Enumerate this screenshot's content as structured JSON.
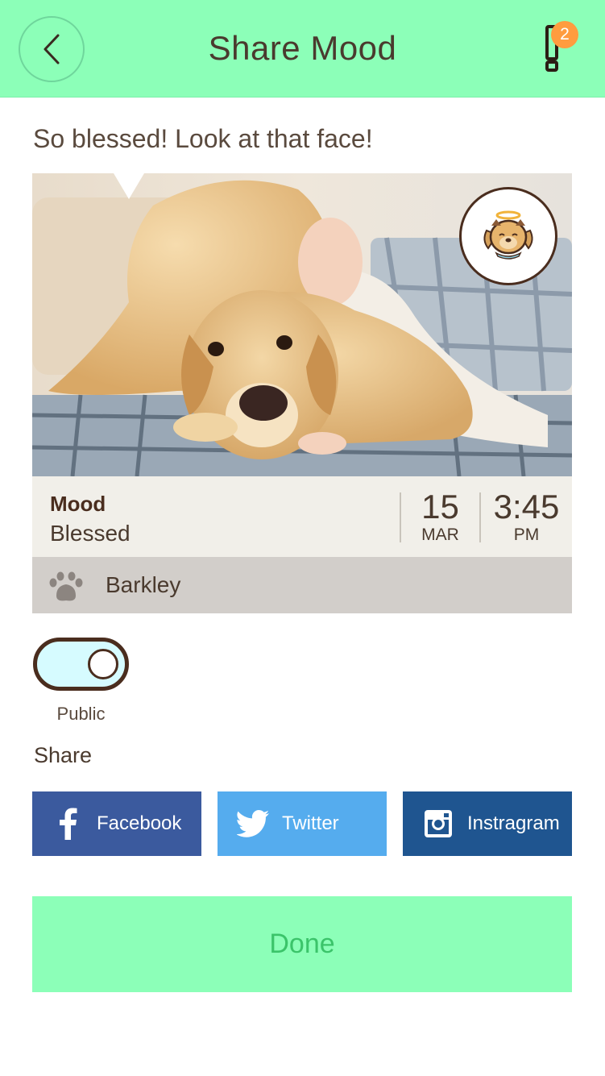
{
  "header": {
    "title": "Share Mood",
    "notification_count": "2"
  },
  "post": {
    "caption": "So blessed! Look at that face!"
  },
  "mood": {
    "label": "Mood",
    "value": "Blessed",
    "day": "15",
    "month": "MAR",
    "time": "3:45",
    "ampm": "PM"
  },
  "pet": {
    "name": "Barkley"
  },
  "privacy": {
    "label": "Public",
    "enabled": true
  },
  "share": {
    "title": "Share",
    "buttons": [
      {
        "label": "Facebook",
        "color": "#3b5a9e"
      },
      {
        "label": "Twitter",
        "color": "#55acee"
      },
      {
        "label": "Instragram",
        "color": "#1f5590"
      }
    ]
  },
  "done": {
    "label": "Done"
  },
  "colors": {
    "accent": "#8cffb8",
    "brand_brown": "#4a2d1e",
    "badge_orange": "#ff9c3f"
  }
}
